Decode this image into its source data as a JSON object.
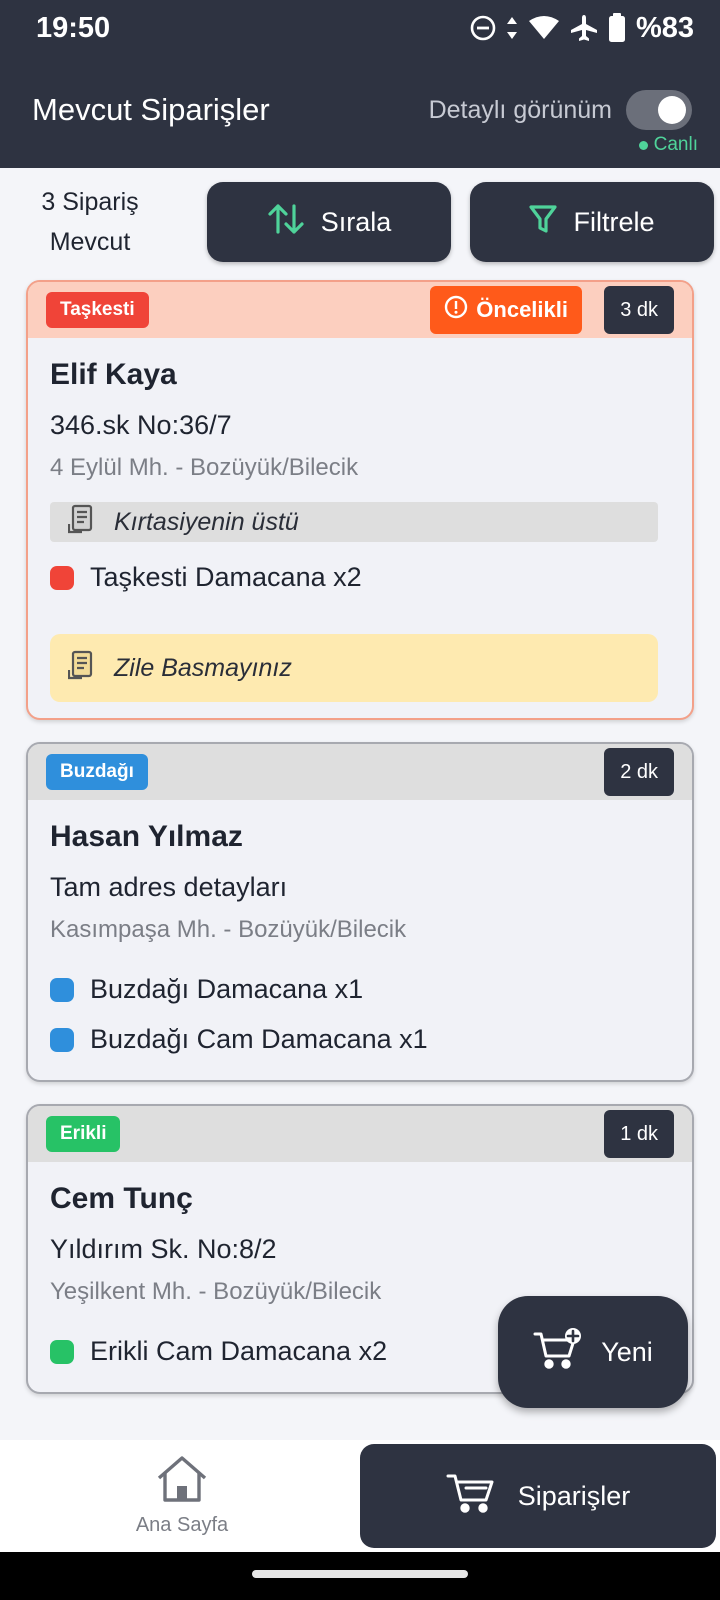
{
  "status_bar": {
    "time": "19:50",
    "battery": "%83",
    "icons": [
      "dnd-icon",
      "data-arrows-icon",
      "wifi-icon",
      "airplane-icon",
      "battery-icon"
    ]
  },
  "app_bar": {
    "title": "Mevcut Siparişler",
    "detail_view_label": "Detaylı görünüm",
    "detail_view_on": true,
    "live_label": "Canlı"
  },
  "toolbar": {
    "count_line1": "3 Sipariş",
    "count_line2": "Mevcut",
    "sort_label": "Sırala",
    "filter_label": "Filtrele"
  },
  "orders": [
    {
      "brand": "Taşkesti",
      "brand_color": "#f04438",
      "priority": true,
      "priority_label": "Öncelikli",
      "minutes": "3 dk",
      "customer": "Elif Kaya",
      "street": "346.sk No:36/7",
      "district": "4 Eylül Mh. - Bozüyük/Bilecik",
      "address_note": "Kırtasiyenin üstü",
      "items": [
        {
          "label": "Taşkesti Damacana x2",
          "color": "#f04438"
        }
      ],
      "order_note": "Zile Basmayınız"
    },
    {
      "brand": "Buzdağı",
      "brand_color": "#2f8fdc",
      "priority": false,
      "minutes": "2 dk",
      "customer": "Hasan Yılmaz",
      "street": "Tam adres detayları",
      "district": "Kasımpaşa Mh. - Bozüyük/Bilecik",
      "items": [
        {
          "label": "Buzdağı Damacana x1",
          "color": "#2f8fdc"
        },
        {
          "label": "Buzdağı Cam Damacana x1",
          "color": "#2f8fdc"
        }
      ]
    },
    {
      "brand": "Erikli",
      "brand_color": "#27c266",
      "priority": false,
      "minutes": "1 dk",
      "customer": "Cem Tunç",
      "street": "Yıldırım Sk. No:8/2",
      "district": "Yeşilkent Mh. - Bozüyük/Bilecik",
      "items": [
        {
          "label": "Erikli Cam Damacana x2",
          "color": "#27c266"
        }
      ]
    }
  ],
  "fab": {
    "label": "Yeni"
  },
  "bottom_nav": {
    "home_label": "Ana Sayfa",
    "orders_label": "Siparişler",
    "active": "Siparişler"
  },
  "colors": {
    "primary_dark": "#2e3341",
    "priority_orange": "#ff5a1a",
    "live_green": "#4fd39a"
  }
}
